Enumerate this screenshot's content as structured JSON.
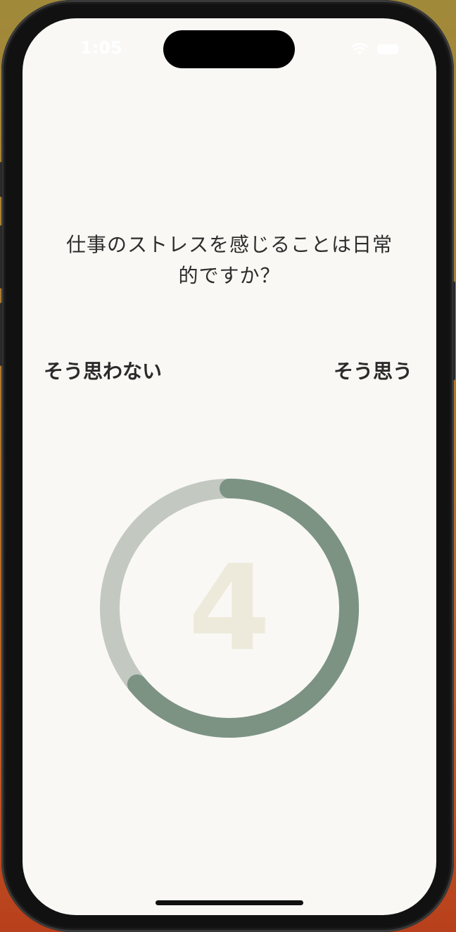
{
  "status_bar": {
    "time": "1:05"
  },
  "question": {
    "text": "仕事のストレスを感じることは日常的ですか？"
  },
  "scale": {
    "left_label": "そう思わない",
    "right_label": "そう思う"
  },
  "dial": {
    "value": "4",
    "progress_fraction": 0.64,
    "track_color": "#c3c9c1",
    "progress_color": "#7c9383",
    "value_color": "#eeeadb"
  },
  "icons": {
    "wifi": "wifi-icon",
    "battery": "battery-icon"
  }
}
